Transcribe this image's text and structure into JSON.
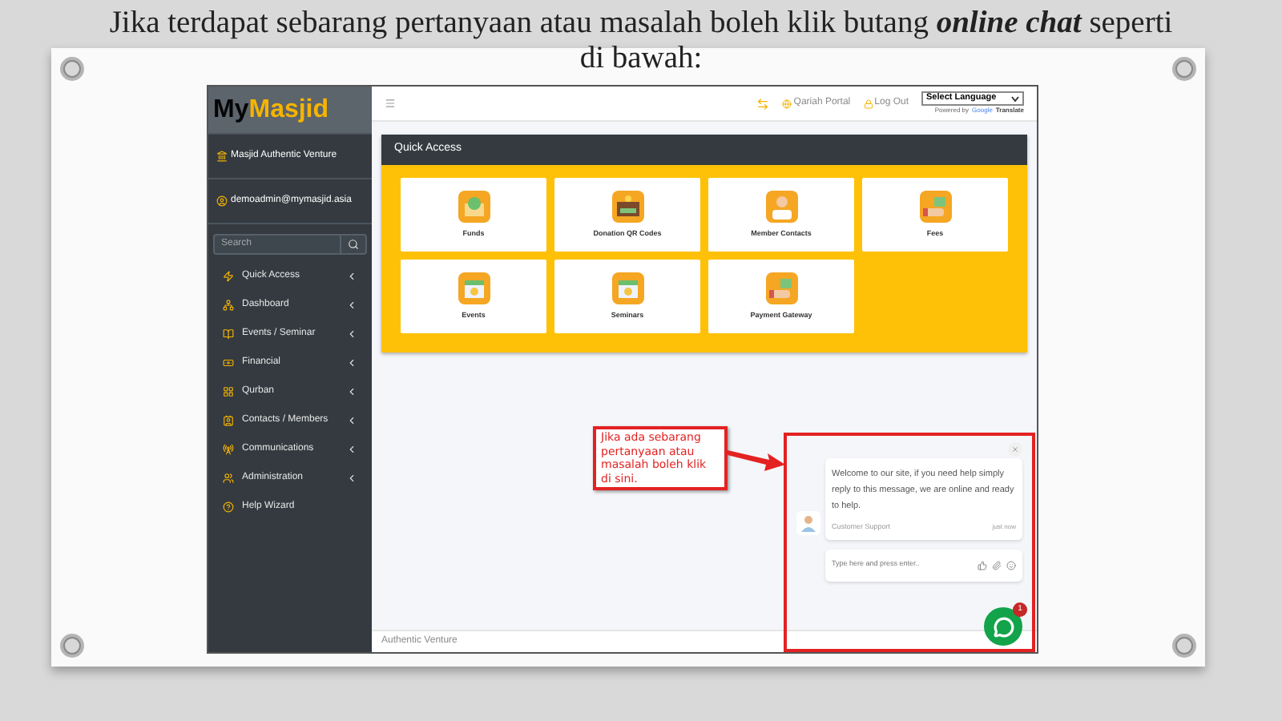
{
  "slide_title": "Jika terdapat sebarang pertanyaan atau masalah boleh klik butang **online chat** seperti di bawah:",
  "sidebar": {
    "logo_first": "My",
    "logo_second": "Masjid",
    "organization": "Masjid Authentic Venture",
    "user": "demoadmin@mymasjid.asia",
    "search": {
      "placeholder": "Search"
    },
    "items": [
      {
        "label": "Quick Access",
        "expandable": true
      },
      {
        "label": "Dashboard",
        "expandable": true
      },
      {
        "label": "Events / Seminar",
        "expandable": true
      },
      {
        "label": "Financial",
        "expandable": true
      },
      {
        "label": "Qurban",
        "expandable": true
      },
      {
        "label": "Contacts / Members",
        "expandable": true
      },
      {
        "label": "Communications",
        "expandable": true
      },
      {
        "label": "Administration",
        "expandable": true
      },
      {
        "label": "Help Wizard",
        "expandable": false
      }
    ]
  },
  "topbar": {
    "links": [
      "Qariah Portal",
      "Log Out"
    ],
    "language_select": "Select Language",
    "powered_by": "Powered by",
    "google": "Google",
    "translate": "Translate"
  },
  "quick_access": {
    "title": "Quick Access",
    "tiles": [
      "Funds",
      "Donation QR Codes",
      "Member Contacts",
      "Fees",
      "Events",
      "Seminars",
      "Payment Gateway"
    ]
  },
  "callout": "Jika ada sebarang pertanyaan atau masalah boleh klik di sini.",
  "chat": {
    "message": "Welcome to our site, if you need help simply reply to this message, we are online and ready to help.",
    "sender": "Customer Support",
    "time": "just now",
    "input": {
      "placeholder": "Type here and press enter.."
    },
    "badge": "1"
  },
  "footer": "Authentic Venture"
}
